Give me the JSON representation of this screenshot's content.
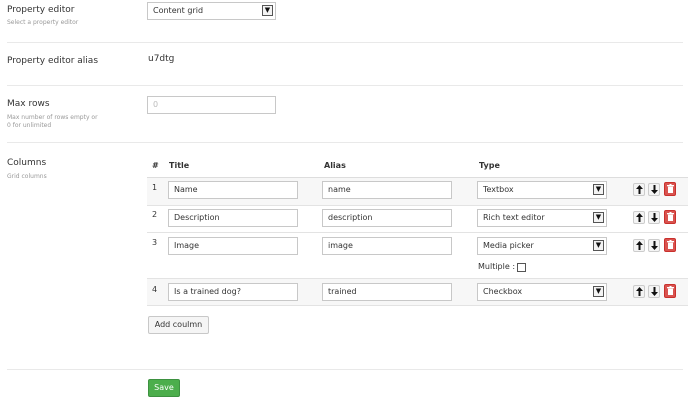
{
  "property_editor": {
    "label": "Property editor",
    "description": "Select a property editor",
    "selected": "Content grid"
  },
  "alias": {
    "label": "Property editor alias",
    "value": "u7dtg"
  },
  "max_rows": {
    "label": "Max rows",
    "description_line1": "Max number of rows empty or",
    "description_line2": "0 for unlimited",
    "placeholder": "0"
  },
  "columns": {
    "label": "Columns",
    "description": "Grid columns",
    "headers": {
      "num": "#",
      "title": "Title",
      "alias": "Alias",
      "type": "Type"
    },
    "rows": [
      {
        "num": "1",
        "title": "Name",
        "alias": "name",
        "type": "Textbox"
      },
      {
        "num": "2",
        "title": "Description",
        "alias": "description",
        "type": "Rich text editor"
      },
      {
        "num": "3",
        "title": "Image",
        "alias": "image",
        "type": "Media picker",
        "multiple_label": "Multiple :",
        "multiple_checked": false
      },
      {
        "num": "4",
        "title": "Is a trained dog?",
        "alias": "trained",
        "type": "Checkbox"
      }
    ],
    "add_label": "Add coulmn"
  },
  "save_label": "Save",
  "icons": {
    "select_arrow": "chevron-down-icon",
    "move_up": "arrow-up-icon",
    "move_down": "arrow-down-icon",
    "delete": "trash-icon"
  },
  "colors": {
    "save": "#4cae4c",
    "delete": "#d9534f"
  }
}
